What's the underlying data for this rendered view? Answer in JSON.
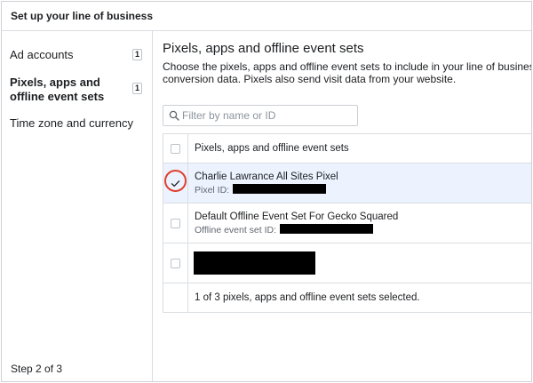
{
  "header": {
    "title": "Set up your line of business"
  },
  "sidebar": {
    "steps": [
      {
        "label": "Ad accounts",
        "count": "1"
      },
      {
        "label": "Pixels, apps and offline event sets",
        "count": "1"
      },
      {
        "label": "Time zone and currency"
      }
    ],
    "step_counter": "Step 2 of 3"
  },
  "main": {
    "title": "Pixels, apps and offline event sets",
    "description_line1": "Choose the pixels, apps and offline event sets to include in your line of business.",
    "description_line2": "conversion data. Pixels also send visit data from your website.",
    "search": {
      "placeholder": "Filter by name or ID"
    },
    "table": {
      "header": "Pixels, apps and offline event sets",
      "rows": [
        {
          "name": "Charlie Lawrance All Sites Pixel",
          "sub_label": "Pixel ID:",
          "checked": true
        },
        {
          "name": "Default Offline Event Set For Gecko Squared",
          "sub_label": "Offline event set ID:",
          "checked": false
        },
        {
          "name": "",
          "sub_label": "",
          "checked": false
        }
      ],
      "footer": "1 of 3 pixels, apps and offline event sets selected."
    }
  },
  "colors": {
    "selected_row": "#ecf3ff",
    "highlight_ring": "#e0402e",
    "border": "#dadde1"
  }
}
